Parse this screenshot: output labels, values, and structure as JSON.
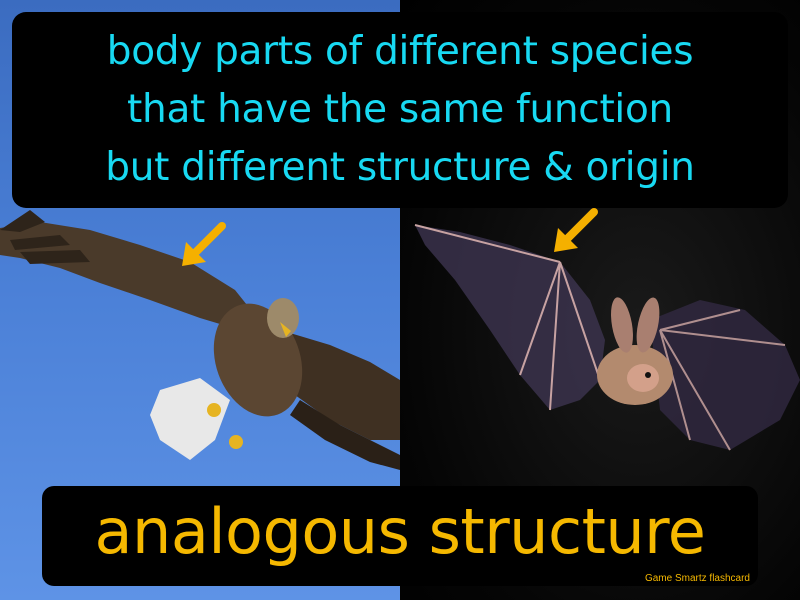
{
  "definition": {
    "lines": [
      "body parts of different species",
      "that have the same function",
      "but different structure & origin"
    ],
    "color": "#18d9f2"
  },
  "term": {
    "text": "analogous structure",
    "color": "#f5b800"
  },
  "watermark": "Game Smartz  flashcard",
  "images": {
    "left": "eagle-photo",
    "right": "bat-photo"
  },
  "colors": {
    "sky": "#4a7fd6",
    "dark_background": "#000000",
    "arrow": "#f5b000"
  }
}
